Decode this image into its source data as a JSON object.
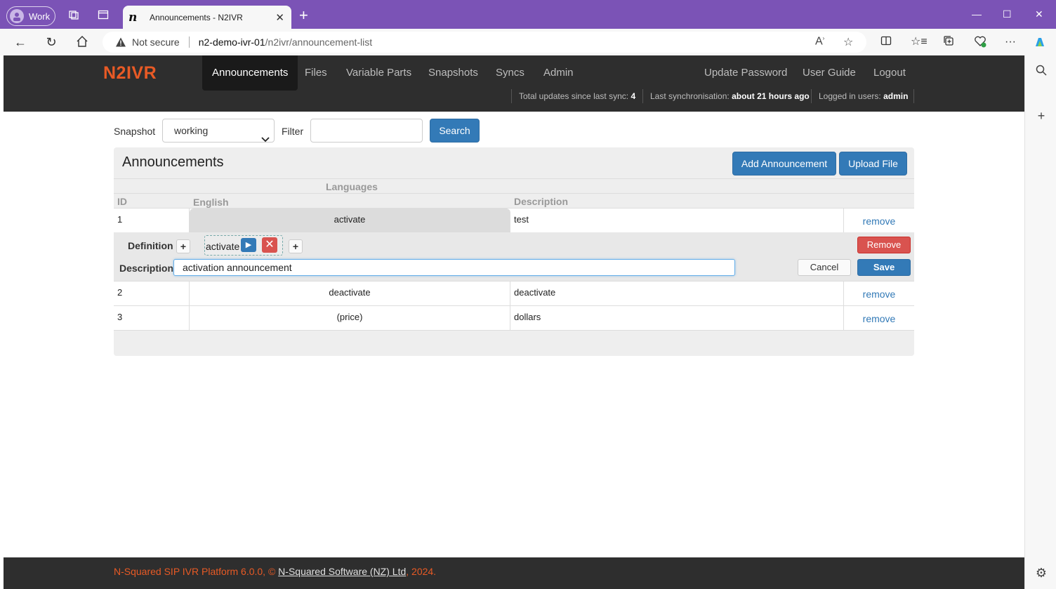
{
  "browser": {
    "profile_label": "Work",
    "tab_title": "Announcements - N2IVR",
    "tab_favicon": "n",
    "not_secure": "Not secure",
    "url_host": "n2-demo-ivr-01",
    "url_path": "/n2ivr/announcement-list"
  },
  "nav": {
    "brand": "N2IVR",
    "items": [
      "Announcements",
      "Files",
      "Variable Parts",
      "Snapshots",
      "Syncs",
      "Admin"
    ],
    "right_items": [
      "Update Password",
      "User Guide",
      "Logout"
    ],
    "status": {
      "updates_label": "Total updates since last sync:",
      "updates_value": "4",
      "last_sync_label": "Last synchronisation:",
      "last_sync_value": "about 21 hours ago",
      "users_label": "Logged in users:",
      "users_value": "admin"
    }
  },
  "toolbar": {
    "snapshot_label": "Snapshot",
    "snapshot_value": "working",
    "filter_label": "Filter",
    "filter_value": "",
    "search_label": "Search"
  },
  "panel": {
    "title": "Announcements",
    "add_label": "Add Announcement",
    "upload_label": "Upload File",
    "headers": {
      "languages": "Languages",
      "id": "ID",
      "english": "English",
      "description": "Description"
    },
    "rows": [
      {
        "id": "1",
        "english": "activate",
        "description": "test",
        "action": "remove"
      },
      {
        "id": "2",
        "english": "deactivate",
        "description": "deactivate",
        "action": "remove"
      },
      {
        "id": "3",
        "english": "(price)",
        "description": "dollars",
        "action": "remove"
      }
    ],
    "edit": {
      "definition_label": "Definition",
      "chip_label": "activate",
      "description_label": "Description",
      "description_value": "activation announcement",
      "remove_label": "Remove",
      "cancel_label": "Cancel",
      "save_label": "Save"
    }
  },
  "footer": {
    "prefix": "N-Squared SIP IVR Platform 6.0.0, © ",
    "company": "N-Squared Software (NZ) Ltd",
    "suffix": ", 2024."
  }
}
